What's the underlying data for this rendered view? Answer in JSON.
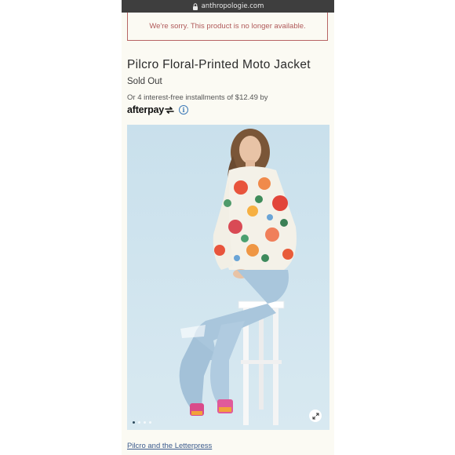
{
  "browser": {
    "url": "anthropologie.com",
    "icon": "lock-icon"
  },
  "notice": {
    "text": "We're sorry. This product is no longer available."
  },
  "product": {
    "title": "Pilcro Floral-Printed Moto Jacket",
    "status": "Sold Out",
    "installments_text": "Or 4 interest-free installments of $12.49 by",
    "afterpay_label": "afterpay",
    "info_icon": "info-icon"
  },
  "gallery": {
    "image_icon": "product-photo",
    "slide_count": 4,
    "active_slide": 1,
    "expand_icon": "expand-icon"
  },
  "brand": {
    "link_text": "Pilcro and the Letterpress"
  },
  "colors": {
    "page_bg": "#fbfaf3",
    "notice_red": "#b05a5a",
    "photo_bg": "#cde3ee",
    "link_blue": "#3a5a8c"
  }
}
